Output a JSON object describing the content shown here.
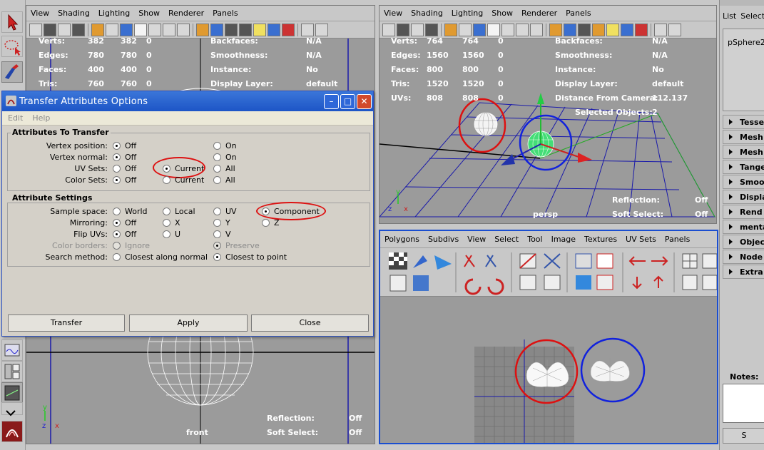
{
  "persp_view": {
    "menu": [
      "View",
      "Shading",
      "Lighting",
      "Show",
      "Renderer",
      "Panels"
    ],
    "stats_left": [
      {
        "label": "Verts:",
        "a": "764",
        "b": "764",
        "c": "0"
      },
      {
        "label": "Edges:",
        "a": "1560",
        "b": "1560",
        "c": "0"
      },
      {
        "label": "Faces:",
        "a": "800",
        "b": "800",
        "c": "0"
      },
      {
        "label": "Tris:",
        "a": "1520",
        "b": "1520",
        "c": "0"
      },
      {
        "label": "UVs:",
        "a": "808",
        "b": "808",
        "c": "0"
      }
    ],
    "stats_right": [
      {
        "label": "Backfaces:",
        "value": "N/A"
      },
      {
        "label": "Smoothness:",
        "value": "N/A"
      },
      {
        "label": "Instance:",
        "value": "No"
      },
      {
        "label": "Display Layer:",
        "value": "default"
      },
      {
        "label": "Distance From Camera:",
        "value": "112.137"
      },
      {
        "label": "Selected Objects:",
        "value": "2"
      }
    ],
    "reflection_label": "Reflection:",
    "reflection_value": "Off",
    "soft_select_label": "Soft Select:",
    "soft_select_value": "Off",
    "camera": "persp"
  },
  "front_view": {
    "menu": [
      "View",
      "Shading",
      "Lighting",
      "Show",
      "Renderer",
      "Panels"
    ],
    "stats_left": [
      {
        "label": "Verts:",
        "a": "382",
        "b": "382",
        "c": "0"
      },
      {
        "label": "Edges:",
        "a": "780",
        "b": "780",
        "c": "0"
      },
      {
        "label": "Faces:",
        "a": "400",
        "b": "400",
        "c": "0"
      },
      {
        "label": "Tris:",
        "a": "760",
        "b": "760",
        "c": "0"
      }
    ],
    "stats_right": [
      {
        "label": "Backfaces:",
        "value": "N/A"
      },
      {
        "label": "Smoothness:",
        "value": "N/A"
      },
      {
        "label": "Instance:",
        "value": "No"
      },
      {
        "label": "Display Layer:",
        "value": "default"
      }
    ],
    "reflection_label": "Reflection:",
    "reflection_value": "Off",
    "soft_select_label": "Soft Select:",
    "soft_select_value": "Off",
    "camera": "front"
  },
  "uv_editor": {
    "menu": [
      "Polygons",
      "Subdivs",
      "View",
      "Select",
      "Tool",
      "Image",
      "Textures",
      "UV Sets",
      "Panels"
    ]
  },
  "dialog": {
    "title": "Transfer Attributes Options",
    "menu": [
      "Edit",
      "Help"
    ],
    "group1_title": "Attributes To Transfer",
    "vertex_position": {
      "label": "Vertex position:",
      "opt1": "Off",
      "opt2": "On"
    },
    "vertex_normal": {
      "label": "Vertex normal:",
      "opt1": "Off",
      "opt2": "On"
    },
    "uv_sets": {
      "label": "UV Sets:",
      "opt1": "Off",
      "opt2": "Current",
      "opt3": "All"
    },
    "color_sets": {
      "label": "Color Sets:",
      "opt1": "Off",
      "opt2": "Current",
      "opt3": "All"
    },
    "group2_title": "Attribute Settings",
    "sample_space": {
      "label": "Sample space:",
      "opt1": "World",
      "opt2": "Local",
      "opt3": "UV",
      "opt4": "Component"
    },
    "mirroring": {
      "label": "Mirroring:",
      "opt1": "Off",
      "opt2": "X",
      "opt3": "Y",
      "opt4": "Z"
    },
    "flip_uvs": {
      "label": "Flip UVs:",
      "opt1": "Off",
      "opt2": "U",
      "opt3": "V"
    },
    "color_borders": {
      "label": "Color borders:",
      "opt1": "Ignore",
      "opt2": "Preserve"
    },
    "search_method": {
      "label": "Search method:",
      "opt1": "Closest along normal",
      "opt2": "Closest to point"
    },
    "buttons": {
      "transfer": "Transfer",
      "apply": "Apply",
      "close": "Close"
    }
  },
  "right_panel": {
    "menu": [
      "List",
      "Selecte"
    ],
    "object_name": "pSphere2",
    "sections": [
      "Tesse",
      "Mesh",
      "Mesh",
      "Tange",
      "Smoo",
      "Displa",
      "Rend",
      "menta",
      "Objec",
      "Node",
      "Extra"
    ],
    "notes_label": "Notes:  p",
    "bottom_btn": "S"
  },
  "colors": {
    "viewport_bg": "#9b9b9b",
    "highlight_circle": "#dd1111",
    "blue_circle": "#1122dd",
    "selection_green": "#22cc55"
  }
}
